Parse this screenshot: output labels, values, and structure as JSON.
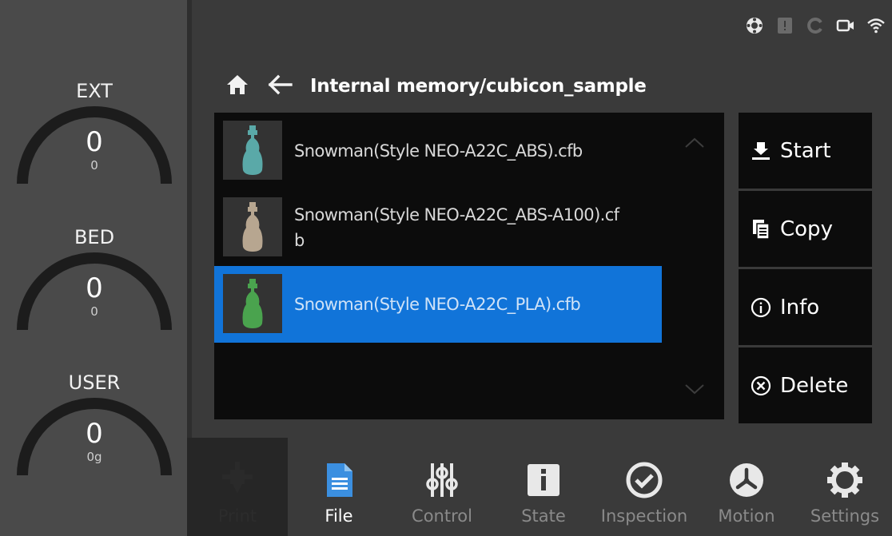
{
  "gauges": [
    {
      "label": "EXT",
      "value": "0",
      "sub": "0"
    },
    {
      "label": "BED",
      "value": "0",
      "sub": "0"
    },
    {
      "label": "USER",
      "value": "0",
      "sub": "0g"
    }
  ],
  "status_icons": [
    "network-hub-icon",
    "alert-icon",
    "sync-icon",
    "camera-icon",
    "wifi-icon"
  ],
  "path": {
    "text": "Internal memory/cubicon_sample"
  },
  "files": [
    {
      "name": "Snowman(Style NEO-A22C_ABS).cfb",
      "thumb_color": "#5aa9a8",
      "selected": false
    },
    {
      "name": "Snowman(Style NEO-A22C_ABS-A100).cf\nb",
      "thumb_color": "#b7a690",
      "selected": false
    },
    {
      "name": "Snowman(Style NEO-A22C_PLA).cfb",
      "thumb_color": "#4aa34e",
      "selected": true
    }
  ],
  "actions": [
    {
      "label": "Start",
      "icon": "print-start-icon"
    },
    {
      "label": "Copy",
      "icon": "copy-icon"
    },
    {
      "label": "Info",
      "icon": "info-icon"
    },
    {
      "label": "Delete",
      "icon": "delete-icon"
    }
  ],
  "nav": [
    {
      "label": "Print",
      "icon": "nozzle-icon",
      "active": false
    },
    {
      "label": "File",
      "icon": "file-icon",
      "active": true
    },
    {
      "label": "Control",
      "icon": "sliders-icon",
      "active": false
    },
    {
      "label": "State",
      "icon": "state-icon",
      "active": false
    },
    {
      "label": "Inspection",
      "icon": "check-circle-icon",
      "active": false
    },
    {
      "label": "Motion",
      "icon": "motion-icon",
      "active": false
    },
    {
      "label": "Settings",
      "icon": "gear-icon",
      "active": false
    }
  ],
  "colors": {
    "accent": "#1174d9",
    "panel": "#0c0c0c",
    "background": "#3a3a3a",
    "active_tab": "#3a3a3a",
    "file_icon": "#3b8fe0"
  }
}
